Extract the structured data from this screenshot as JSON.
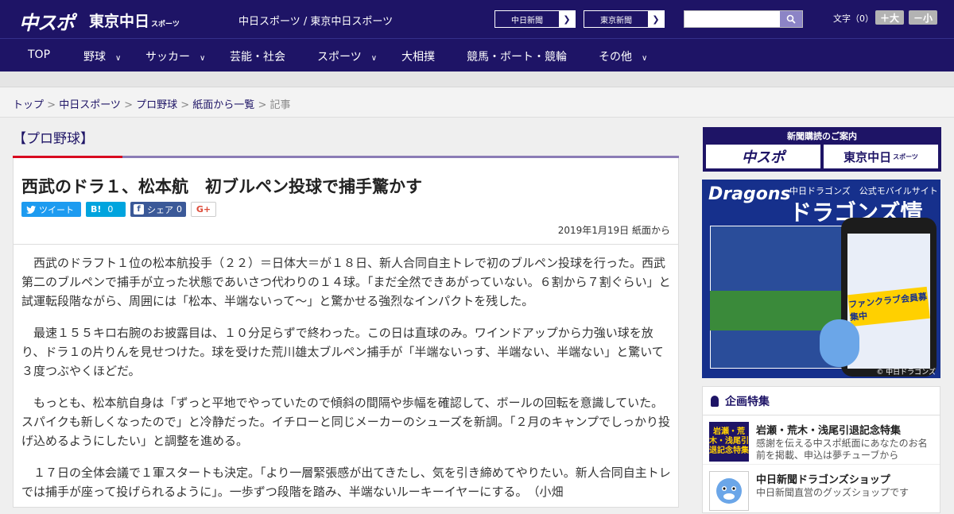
{
  "header": {
    "logo_chunichi_sports": "中スポ",
    "logo_tokyo_chunichi": "東京中日",
    "logo_tokyo_chunichi_small": "スポーツ",
    "site_name": "中日スポーツ / 東京中日スポーツ",
    "links": [
      "中日新聞",
      "東京新聞"
    ],
    "search_placeholder": "",
    "font_label": "文字（0）",
    "font_larger": "＋大",
    "font_smaller": "－小"
  },
  "nav": {
    "items": [
      {
        "label": "TOP",
        "dropdown": false
      },
      {
        "label": "野球",
        "dropdown": true
      },
      {
        "label": "サッカー",
        "dropdown": true
      },
      {
        "label": "芸能・社会",
        "dropdown": false
      },
      {
        "label": "スポーツ",
        "dropdown": true
      },
      {
        "label": "大相撲",
        "dropdown": false
      },
      {
        "label": "競馬・ボート・競輪",
        "dropdown": false
      },
      {
        "label": "その他",
        "dropdown": true
      }
    ]
  },
  "breadcrumb": {
    "items": [
      "トップ",
      "中日スポーツ",
      "プロ野球",
      "紙面から一覧"
    ],
    "current": "記事",
    "separator": " > "
  },
  "article": {
    "section": "【プロ野球】",
    "headline": "西武のドラ１、松本航　初ブルペン投球で捕手驚かす",
    "share": {
      "tweet": "ツイート",
      "hatena_icon": "B!",
      "hatena_count": "0",
      "facebook_icon": "f",
      "facebook_label": "シェア",
      "facebook_count": "0",
      "gplus": "G+"
    },
    "date": "2019年1月19日 紙面から",
    "paragraphs": [
      "西武のドラフト１位の松本航投手（２２）＝日体大＝が１８日、新人合同自主トレで初のブルペン投球を行った。西武第二のブルペンで捕手が立った状態であいさつ代わりの１４球。「まだ全然できあがっていない。６割から７割ぐらい」と試運転段階ながら、周囲には「松本、半端ないって～」と驚かせる強烈なインパクトを残した。",
      "最速１５５キロ右腕のお披露目は、１０分足らずで終わった。この日は直球のみ。ワインドアップから力強い球を放り、ドラ１の片りんを見せつけた。球を受けた荒川雄太ブルペン捕手が「半端ないっす、半端ない、半端ない」と驚いて３度つぶやくほどだ。",
      "もっとも、松本航自身は「ずっと平地でやっていたので傾斜の間隔や歩幅を確認して、ボールの回転を意識していた。スパイクも新しくなったので」と冷静だった。イチローと同じメーカーのシューズを新調。「２月のキャンプでしっかり投げ込めるようにしたい」と調整を進める。",
      "１７日の全体会議で１軍スタートも決定。「より一層緊張感が出てきたし、気を引き締めてやりたい。新人合同自主トレでは捕手が座って投げられるように」。一歩ずつ段階を踏み、半端ないルーキーイヤーにする。　（小畑"
    ]
  },
  "sidebar": {
    "subscription": {
      "title": "新聞購読のご案内",
      "logos": [
        "中スポ",
        "東京中日"
      ],
      "small": "スポーツ"
    },
    "dragons_ad": {
      "logo": "Dragons",
      "sub": "中日ドラゴンズ　公式モバイルサイト",
      "main": "ドラゴンズ情報",
      "banner": "ファンクラブ会員募集中",
      "footer": "© 中日ドラゴンズ"
    },
    "features": {
      "title": "企画特集",
      "items": [
        {
          "thumb": "岩瀬・荒木・浅尾引退記念特集",
          "title": "岩瀬・荒木・浅尾引退記念特集",
          "desc": "感謝を伝える中スポ紙面にあなたのお名前を掲載、申込は夢チューブから"
        },
        {
          "thumb": "",
          "title": "中日新聞ドラゴンズショップ",
          "desc": "中日新聞直営のグッズショップです"
        }
      ]
    }
  }
}
